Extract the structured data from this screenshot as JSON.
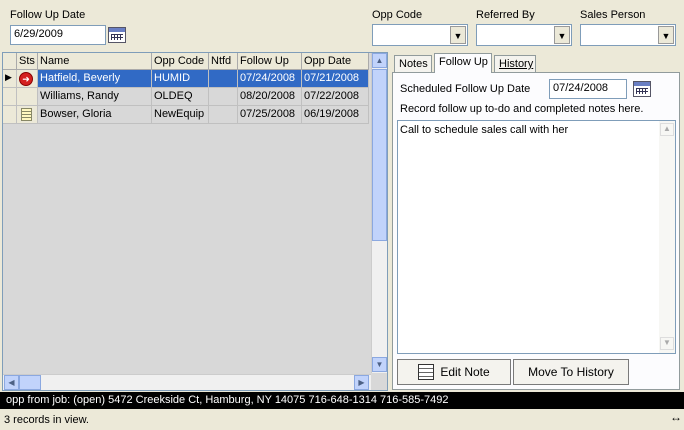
{
  "filters": {
    "follow_up_date_label": "Follow Up Date",
    "follow_up_date_value": "6/29/2009",
    "opp_code_label": "Opp Code",
    "referred_by_label": "Referred By",
    "sales_person_label": "Sales Person"
  },
  "grid": {
    "columns": [
      "Sts",
      "Name",
      "Opp Code",
      "Ntfd",
      "Follow Up",
      "Opp Date"
    ],
    "rows": [
      {
        "sts_icon": "stop-arrow-icon",
        "name": "Hatfield, Beverly",
        "opp_code": "HUMID",
        "ntfd": "",
        "follow_up": "07/24/2008",
        "opp_date": "07/21/2008",
        "selected": true
      },
      {
        "sts_icon": "",
        "name": "Williams, Randy",
        "opp_code": "OLDEQ",
        "ntfd": "",
        "follow_up": "08/20/2008",
        "opp_date": "07/22/2008",
        "selected": false
      },
      {
        "sts_icon": "note-icon",
        "name": "Bowser, Gloria",
        "opp_code": "NewEquip",
        "ntfd": "",
        "follow_up": "07/25/2008",
        "opp_date": "06/19/2008",
        "selected": false
      }
    ]
  },
  "tabs": {
    "notes": "Notes",
    "follow_up": "Follow Up",
    "history": "History",
    "active": "follow_up"
  },
  "follow_up_panel": {
    "scheduled_label": "Scheduled Follow Up Date",
    "scheduled_value": "07/24/2008",
    "instruction": "Record follow up to-do and completed notes here.",
    "note_text": "Call to schedule sales call with her"
  },
  "buttons": {
    "edit_note": "Edit Note",
    "move_to_history": "Move To History"
  },
  "status_bar": {
    "text": "opp from job: (open) 5472 Creekside Ct, Hamburg, NY 14075  716-648-1314  716-585-7492",
    "record_count": "3 records in view."
  },
  "colors": {
    "selection": "#316ac5",
    "window_bg": "#ece9d8",
    "status_bg": "#000000"
  }
}
